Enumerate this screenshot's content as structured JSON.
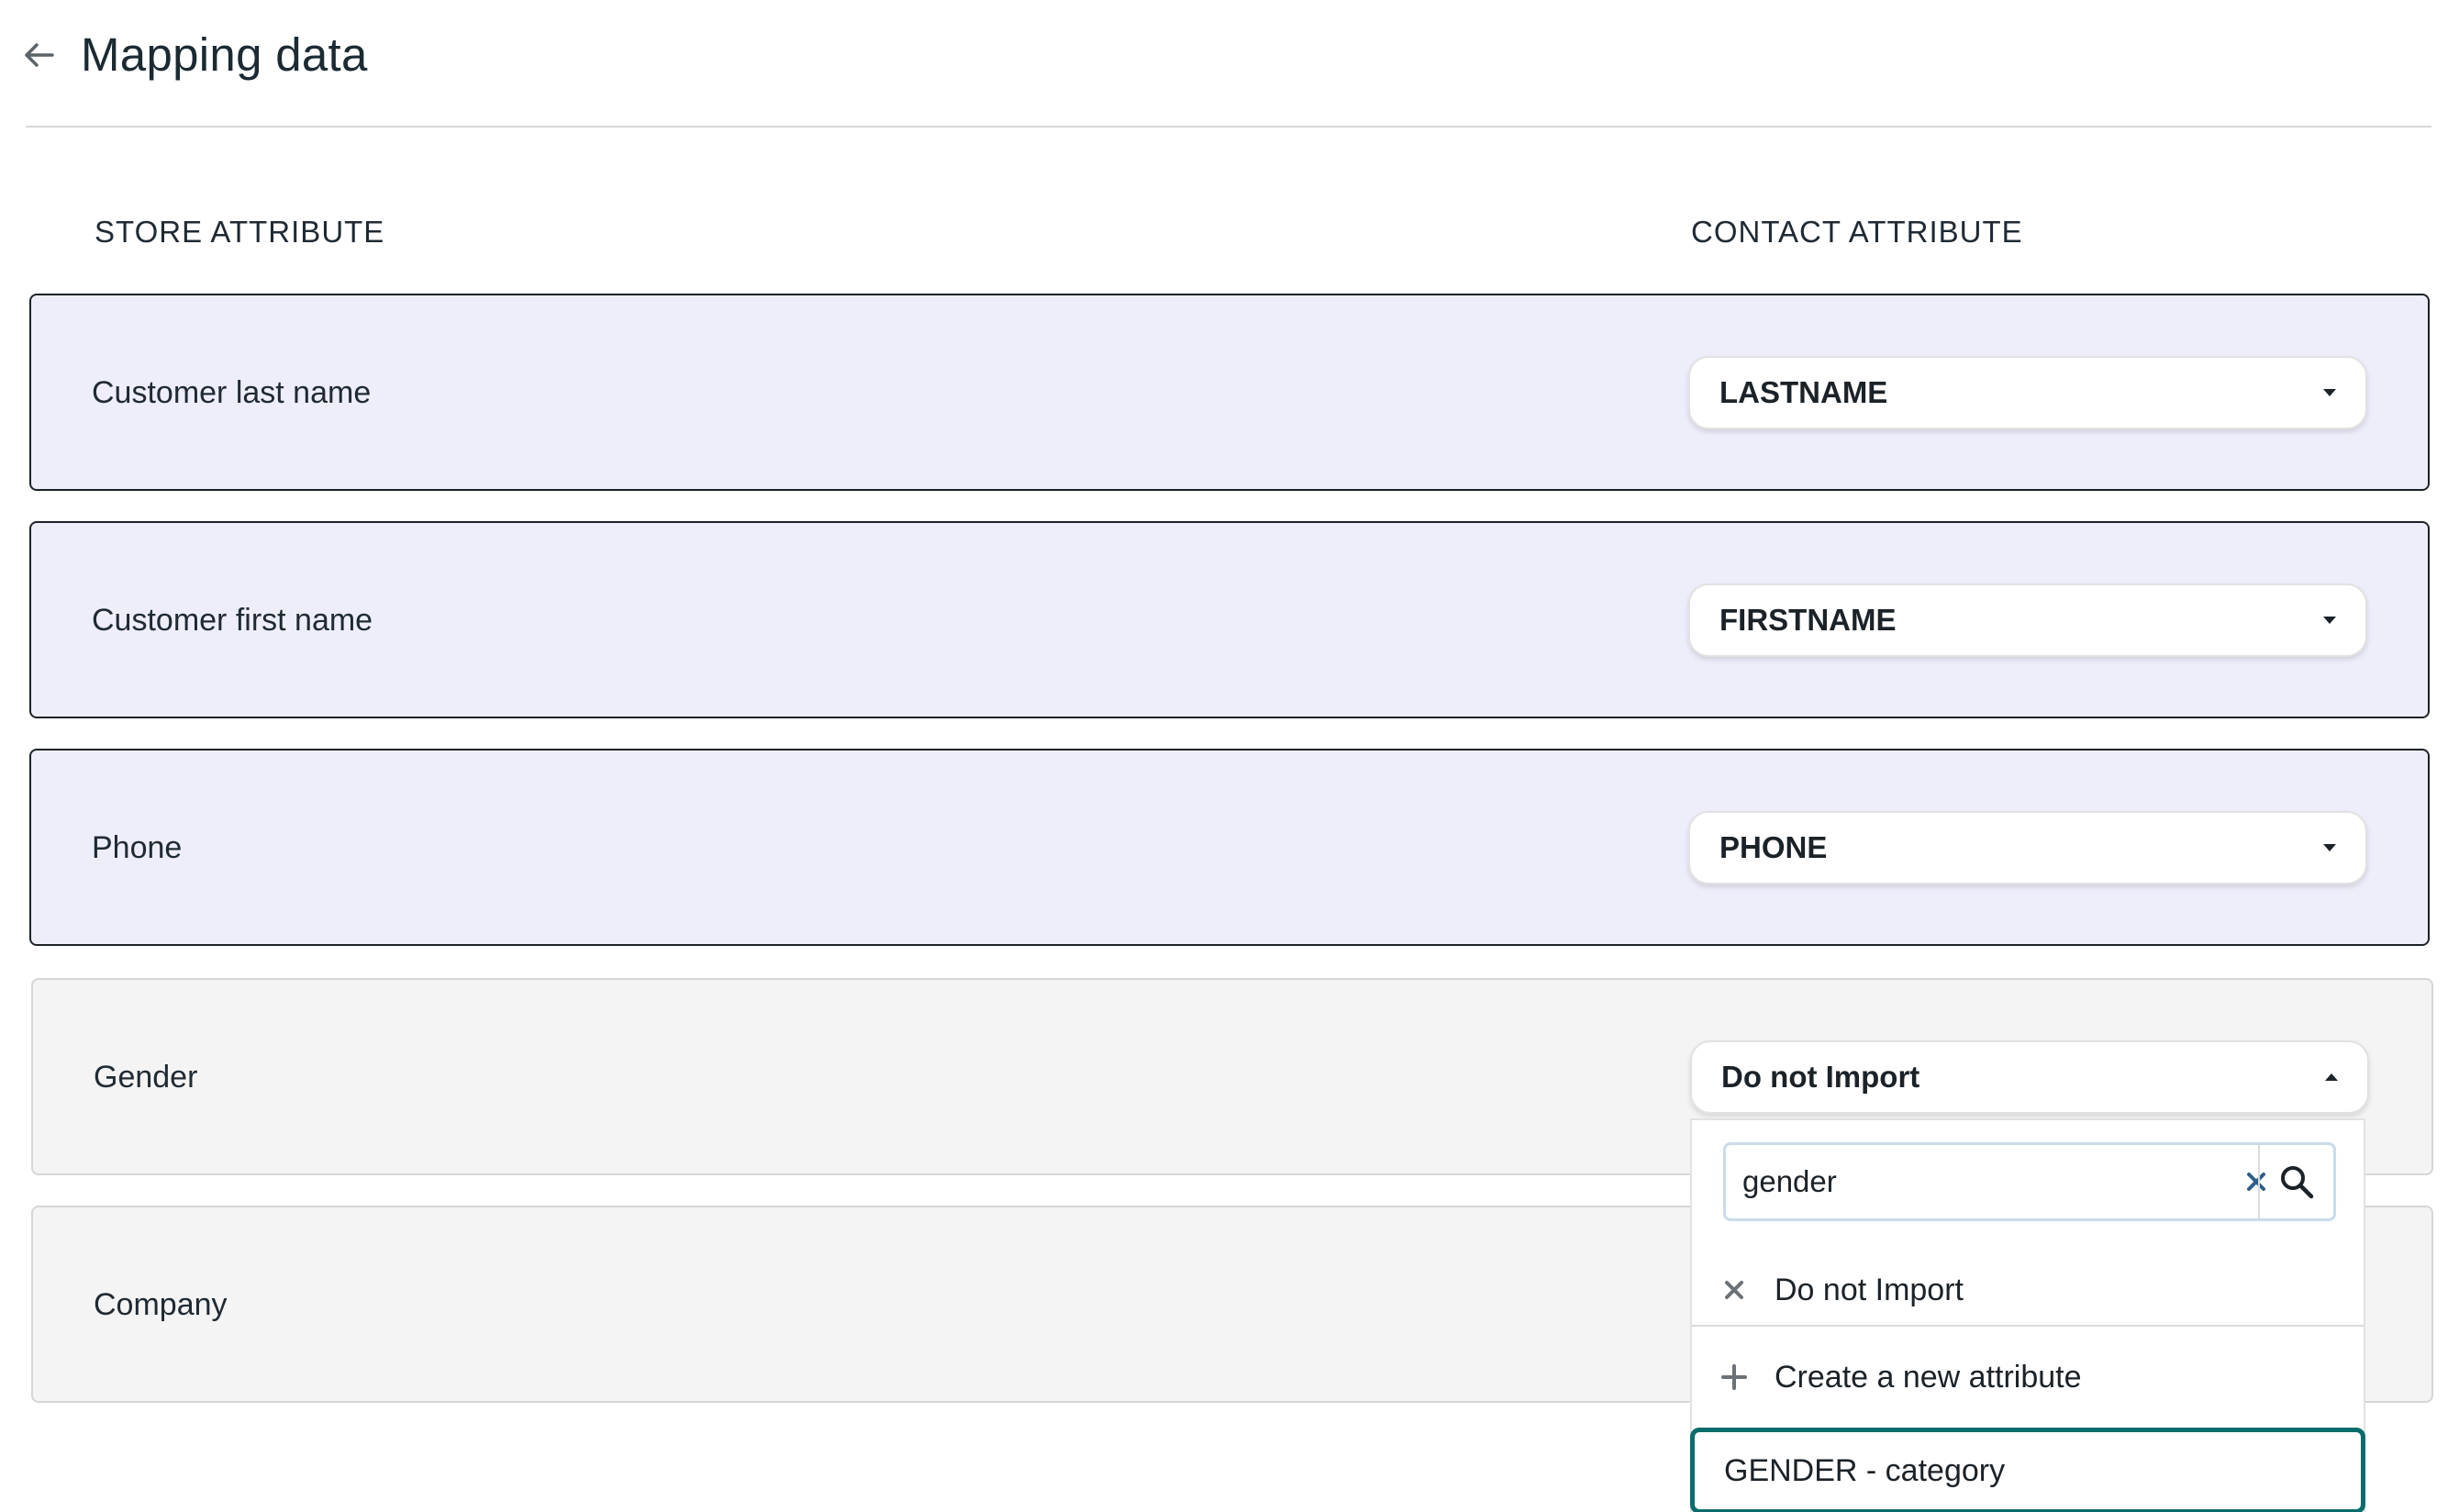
{
  "header": {
    "title": "Mapping data",
    "back_icon": "arrow-left-icon"
  },
  "columns": {
    "store": "STORE ATTRIBUTE",
    "contact": "CONTACT ATTRIBUTE"
  },
  "rows": [
    {
      "store_attribute": "Customer last name",
      "contact_attribute": "LASTNAME",
      "mapped": true
    },
    {
      "store_attribute": "Customer first name",
      "contact_attribute": "FIRSTNAME",
      "mapped": true
    },
    {
      "store_attribute": "Phone",
      "contact_attribute": "PHONE",
      "mapped": true
    },
    {
      "store_attribute": "Gender",
      "contact_attribute": "Do not Import",
      "mapped": false,
      "open": true
    },
    {
      "store_attribute": "Company",
      "mapped": false
    }
  ],
  "dropdown": {
    "search_value": "gender",
    "options": [
      {
        "label": "Do not Import",
        "icon": "close-icon"
      },
      {
        "label": "Create a new attribute",
        "icon": "plus-icon"
      },
      {
        "label": "GENDER - category",
        "highlighted": true
      }
    ]
  },
  "colors": {
    "mapped_row_bg": "#eeeefb",
    "unmapped_row_bg": "#f4f4f4",
    "highlight_border": "#0b6c6c",
    "clear_icon": "#2b5e8c"
  }
}
